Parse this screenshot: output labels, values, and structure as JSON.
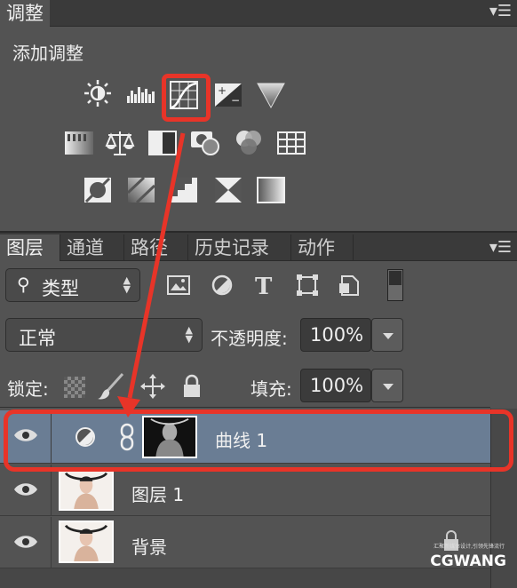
{
  "adjust_panel": {
    "tab_label": "调整",
    "title": "添加调整",
    "icons": [
      "brightness-contrast-icon",
      "levels-icon",
      "curves-icon",
      "exposure-icon",
      "vibrance-icon",
      "hue-saturation-icon",
      "color-balance-icon",
      "black-white-icon",
      "photo-filter-icon",
      "channel-mixer-icon",
      "color-lookup-icon",
      "invert-icon",
      "posterize-icon",
      "threshold-icon",
      "selective-color-icon",
      "gradient-map-icon"
    ],
    "highlighted_icon": "curves-icon"
  },
  "layers_panel": {
    "tabs": [
      "图层",
      "通道",
      "路径",
      "历史记录",
      "动作"
    ],
    "active_tab": "图层",
    "filter_kind": "类型",
    "blend_mode": "正常",
    "opacity_label": "不透明度:",
    "opacity_value": "100%",
    "lock_label": "锁定:",
    "fill_label": "填充:",
    "fill_value": "100%",
    "layers": [
      {
        "name": "曲线 1",
        "selected": true
      },
      {
        "name": "图层 1",
        "selected": false
      },
      {
        "name": "背景",
        "selected": false,
        "locked": true
      }
    ]
  },
  "watermark": {
    "text": "CGWANG",
    "subtext": "汇聚新媒体设计,引领先锋流行"
  },
  "colors": {
    "panel": "#535353",
    "tabbar": "#3a3a3a",
    "selected_layer": "#6a7d94",
    "highlight": "#e83428"
  }
}
